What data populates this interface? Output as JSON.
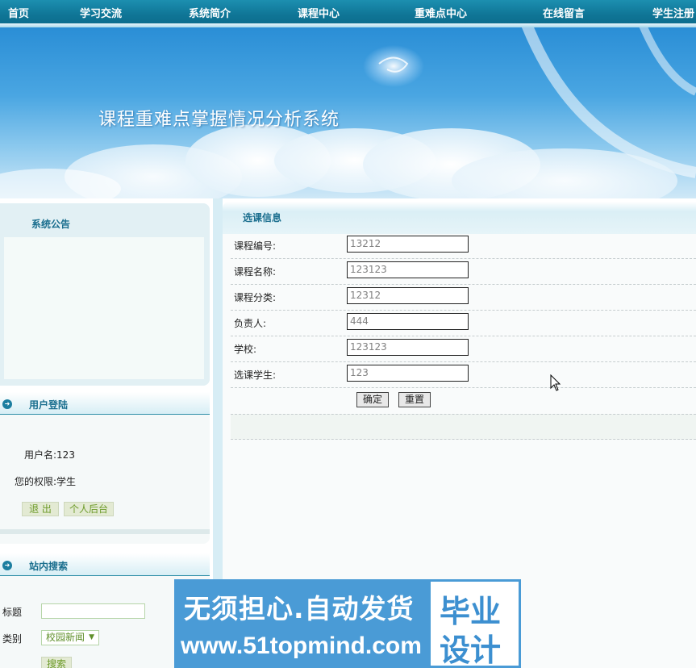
{
  "nav": {
    "items": [
      "首页",
      "学习交流",
      "系统简介",
      "课程中心",
      "重难点中心",
      "在线留言",
      "学生注册"
    ]
  },
  "banner": {
    "title": "课程重难点掌握情况分析系统"
  },
  "notice": {
    "title": "系统公告"
  },
  "login": {
    "title": "用户登陆",
    "username_text": "用户名:123",
    "role_text": "您的权限:学生",
    "logout_label": "退 出",
    "backend_label": "个人后台"
  },
  "search": {
    "title": "站内搜索",
    "title_label": "标题",
    "title_value": "",
    "category_label": "类别",
    "category_selected": "校园新闻",
    "search_label": "搜索"
  },
  "main": {
    "title": "选课信息",
    "fields": [
      {
        "label": "课程编号:",
        "value": "13212"
      },
      {
        "label": "课程名称:",
        "value": "123123"
      },
      {
        "label": "课程分类:",
        "value": "12312"
      },
      {
        "label": "负责人:",
        "value": "444"
      },
      {
        "label": "学校:",
        "value": "123123"
      },
      {
        "label": "选课学生:",
        "value": "123"
      }
    ],
    "confirm_label": "确定",
    "reset_label": "重置"
  },
  "ad": {
    "slogan": "无须担心.自动发货",
    "url": "www.51topmind.com",
    "box_line1": "毕业",
    "box_line2": "设计"
  },
  "colors": {
    "nav_bg": "#0f7596",
    "accent": "#1a6e8e",
    "ad_bg": "#4a9bd6"
  }
}
